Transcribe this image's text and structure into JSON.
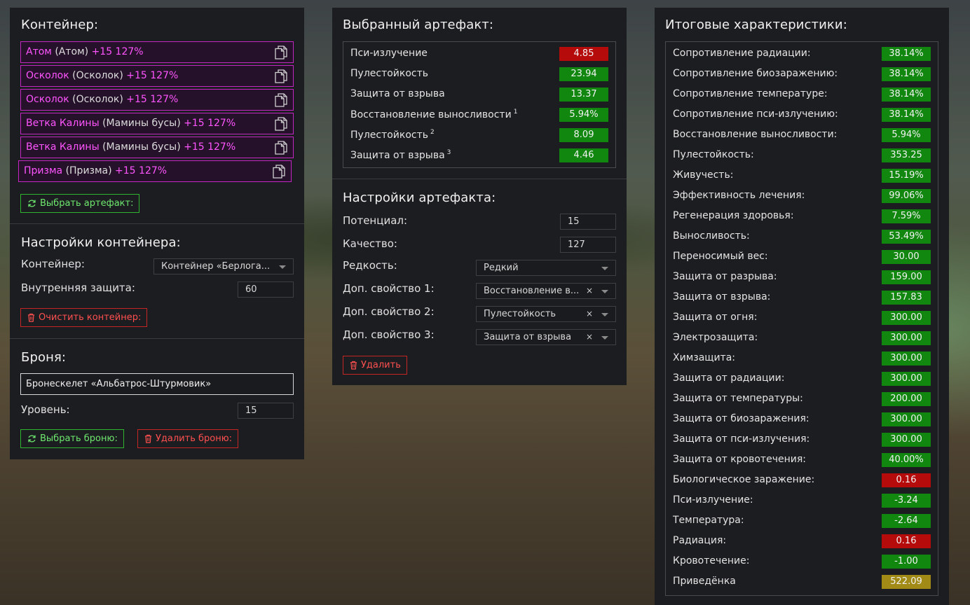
{
  "container_panel": {
    "title": "Контейнер:",
    "artifacts": [
      {
        "name": "Атом",
        "orig": "(Атом)",
        "stat": "+15 127%"
      },
      {
        "name": "Осколок",
        "orig": "(Осколок)",
        "stat": "+15 127%"
      },
      {
        "name": "Осколок",
        "orig": "(Осколок)",
        "stat": "+15 127%"
      },
      {
        "name": "Ветка Калины",
        "orig": "(Мамины бусы)",
        "stat": "+15 127%"
      },
      {
        "name": "Ветка Калины",
        "orig": "(Мамины бусы)",
        "stat": "+15 127%"
      },
      {
        "name": "Призма",
        "orig": "(Призма)",
        "stat": "+15 127%"
      }
    ],
    "select_artifact_label": "Выбрать артефакт:",
    "settings_title": "Настройки контейнера:",
    "container_label": "Контейнер:",
    "container_value": "Контейнер «Берлога...",
    "inner_protection_label": "Внутренняя защита:",
    "inner_protection_value": "60",
    "clear_label": "Очистить контейнер:",
    "armor_title": "Броня:",
    "armor_value": "Бронескелет «Альбатрос-Штурмовик»",
    "level_label": "Уровень:",
    "level_value": "15",
    "select_armor_label": "Выбрать броню:",
    "delete_armor_label": "Удалить броню:"
  },
  "selected_panel": {
    "title": "Выбранный артефакт:",
    "stats": [
      {
        "name": "Пси-излучение",
        "sup": "",
        "value": "4.85",
        "color": "red"
      },
      {
        "name": "Пулестойкость",
        "sup": "",
        "value": "23.94",
        "color": "green"
      },
      {
        "name": "Защита от взрыва",
        "sup": "",
        "value": "13.37",
        "color": "green"
      },
      {
        "name": "Восстановление выносливости",
        "sup": "1",
        "value": "5.94%",
        "color": "green"
      },
      {
        "name": "Пулестойкость",
        "sup": "2",
        "value": "8.09",
        "color": "green"
      },
      {
        "name": "Защита от взрыва",
        "sup": "3",
        "value": "4.46",
        "color": "green"
      }
    ],
    "settings_title": "Настройки артефакта:",
    "potential_label": "Потенциал:",
    "potential_value": "15",
    "quality_label": "Качество:",
    "quality_value": "127",
    "rarity_label": "Редкость:",
    "rarity_value": "Редкий",
    "extra1_label": "Доп. свойство 1:",
    "extra1_value": "Восстановление в...",
    "extra2_label": "Доп. свойство 2:",
    "extra2_value": "Пулестойкость",
    "extra3_label": "Доп. свойство 3:",
    "extra3_value": "Защита от взрыва",
    "clear_x": "×",
    "delete_label": "Удалить"
  },
  "totals_panel": {
    "title": "Итоговые характеристики:",
    "stats": [
      {
        "name": "Сопротивление радиации:",
        "value": "38.14%",
        "color": "green"
      },
      {
        "name": "Сопротивление биозаражению:",
        "value": "38.14%",
        "color": "green"
      },
      {
        "name": "Сопротивление температуре:",
        "value": "38.14%",
        "color": "green"
      },
      {
        "name": "Сопротивление пси-излучению:",
        "value": "38.14%",
        "color": "green"
      },
      {
        "name": "Восстановление выносливости:",
        "value": "5.94%",
        "color": "green"
      },
      {
        "name": "Пулестойкость:",
        "value": "353.25",
        "color": "green"
      },
      {
        "name": "Живучесть:",
        "value": "15.19%",
        "color": "green"
      },
      {
        "name": "Эффективность лечения:",
        "value": "99.06%",
        "color": "green"
      },
      {
        "name": "Регенерация здоровья:",
        "value": "7.59%",
        "color": "green"
      },
      {
        "name": "Выносливость:",
        "value": "53.49%",
        "color": "green"
      },
      {
        "name": "Переносимый вес:",
        "value": "30.00",
        "color": "green"
      },
      {
        "name": "Защита от разрыва:",
        "value": "159.00",
        "color": "green"
      },
      {
        "name": "Защита от взрыва:",
        "value": "157.83",
        "color": "green"
      },
      {
        "name": "Защита от огня:",
        "value": "300.00",
        "color": "green"
      },
      {
        "name": "Электрозащита:",
        "value": "300.00",
        "color": "green"
      },
      {
        "name": "Химзащита:",
        "value": "300.00",
        "color": "green"
      },
      {
        "name": "Защита от радиации:",
        "value": "300.00",
        "color": "green"
      },
      {
        "name": "Защита от температуры:",
        "value": "200.00",
        "color": "green"
      },
      {
        "name": "Защита от биозаражения:",
        "value": "300.00",
        "color": "green"
      },
      {
        "name": "Защита от пси-излучения:",
        "value": "300.00",
        "color": "green"
      },
      {
        "name": "Защита от кровотечения:",
        "value": "40.00%",
        "color": "green"
      },
      {
        "name": "Биологическое заражение:",
        "value": "0.16",
        "color": "red"
      },
      {
        "name": "Пси-излучение:",
        "value": "-3.24",
        "color": "green"
      },
      {
        "name": "Температура:",
        "value": "-2.64",
        "color": "green"
      },
      {
        "name": "Радиация:",
        "value": "0.16",
        "color": "red"
      },
      {
        "name": "Кровотечение:",
        "value": "-1.00",
        "color": "green"
      },
      {
        "name": "Приведёнка",
        "value": "522.09",
        "color": "yellow"
      }
    ]
  },
  "colors": {
    "green": "#11870f",
    "red": "#b50b0b",
    "yellow": "#a18b16",
    "artifact_accent": "#ff54ff"
  }
}
